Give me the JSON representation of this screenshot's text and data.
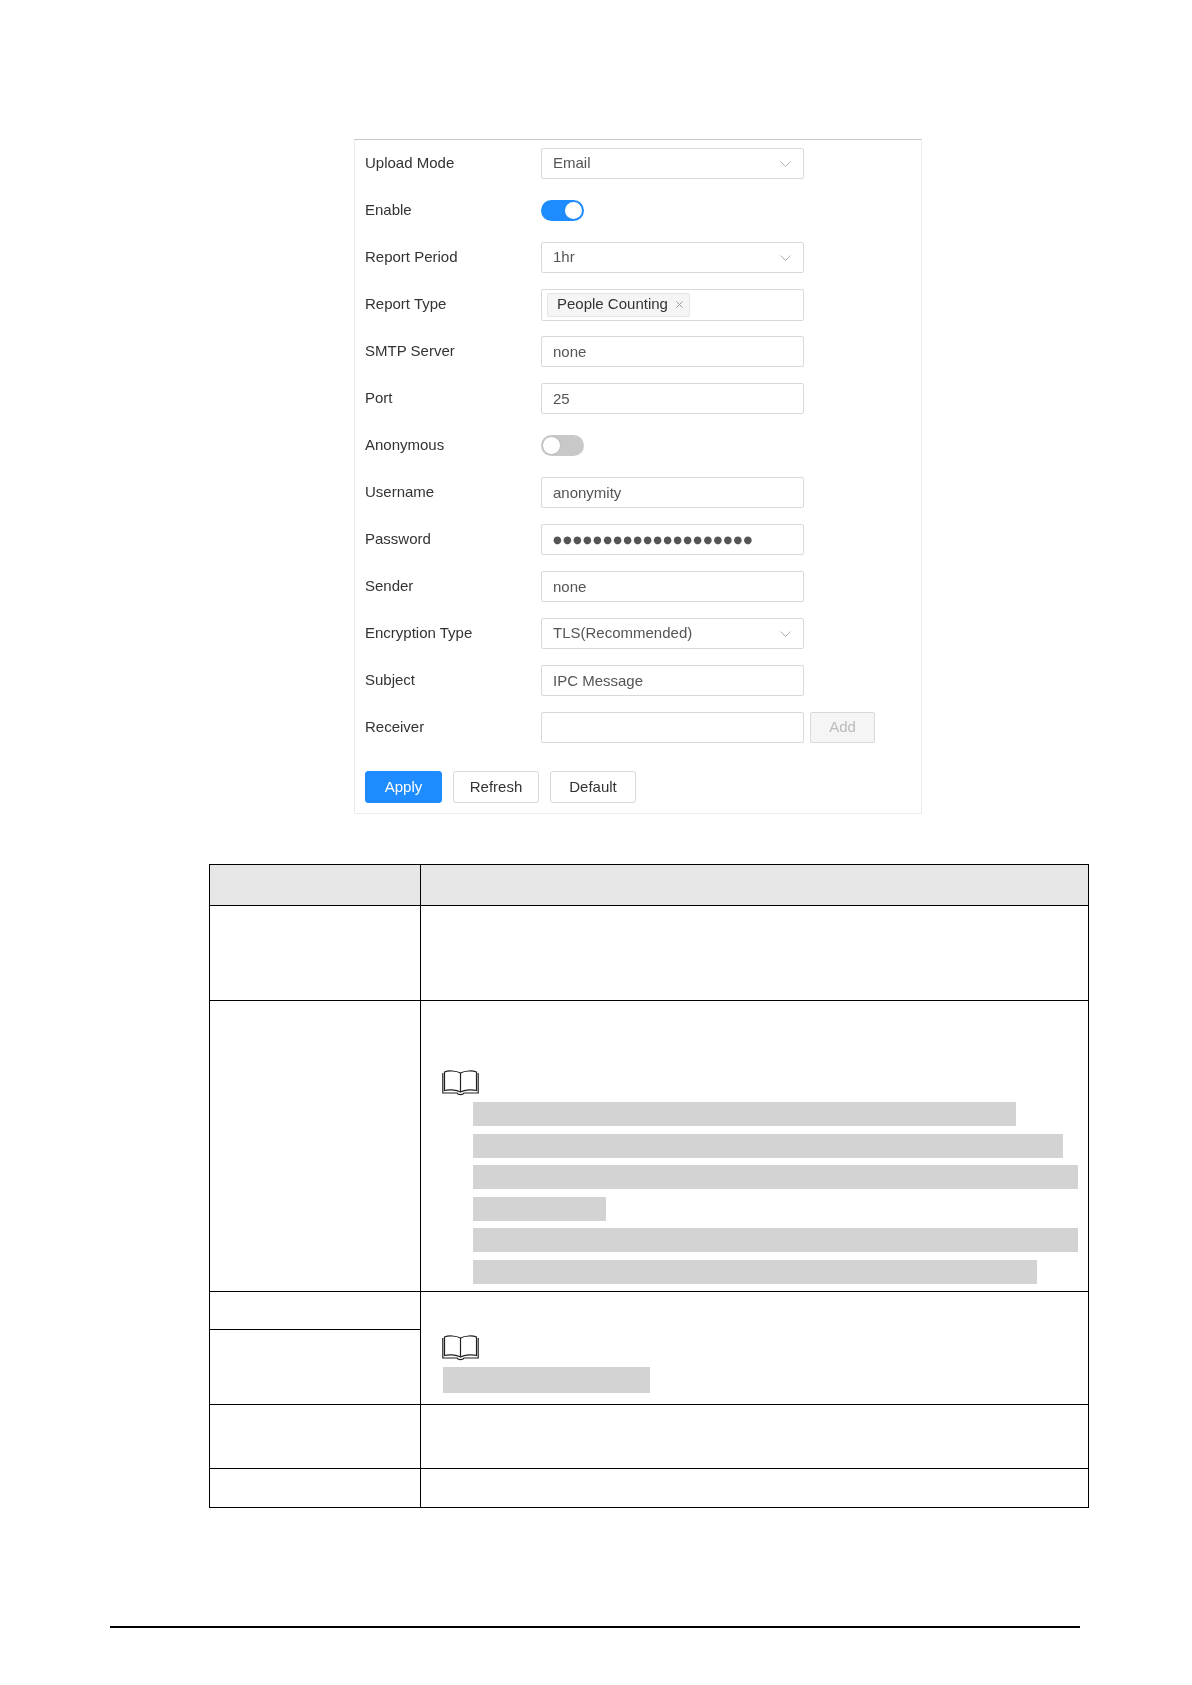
{
  "settings_form": {
    "rows": [
      {
        "kind": "select",
        "label": "Upload Mode",
        "value": "Email"
      },
      {
        "kind": "switch",
        "label": "Enable",
        "on": true
      },
      {
        "kind": "select",
        "label": "Report Period",
        "value": "1hr"
      },
      {
        "kind": "tags",
        "label": "Report Type",
        "tags": [
          "People Counting"
        ]
      },
      {
        "kind": "text",
        "label": "SMTP Server",
        "value": "none"
      },
      {
        "kind": "text",
        "label": "Port",
        "value": "25"
      },
      {
        "kind": "switch",
        "label": "Anonymous",
        "on": false
      },
      {
        "kind": "text",
        "label": "Username",
        "value": "anonymity"
      },
      {
        "kind": "password",
        "label": "Password",
        "value": "●●●●●●●●●●●●●●●●●●●●"
      },
      {
        "kind": "text",
        "label": "Sender",
        "value": "none"
      },
      {
        "kind": "select",
        "label": "Encryption Type",
        "value": "TLS(Recommended)"
      },
      {
        "kind": "text",
        "label": "Subject",
        "value": "IPC Message"
      },
      {
        "kind": "text_with_button",
        "label": "Receiver",
        "button": {
          "label": "Add",
          "disabled": true
        }
      }
    ],
    "buttons": [
      {
        "label": "Apply",
        "primary": true
      },
      {
        "label": "Refresh",
        "primary": false
      },
      {
        "label": "Default",
        "primary": false
      }
    ]
  },
  "parameter_table": {
    "header_cells": [
      {
        "shaded": true
      },
      {
        "shaded": true
      }
    ],
    "rows": [
      {
        "kind": "blank"
      },
      {
        "kind": "note"
      },
      {
        "kind": "split_note"
      },
      {
        "kind": "blank"
      },
      {
        "kind": "blank"
      }
    ]
  }
}
